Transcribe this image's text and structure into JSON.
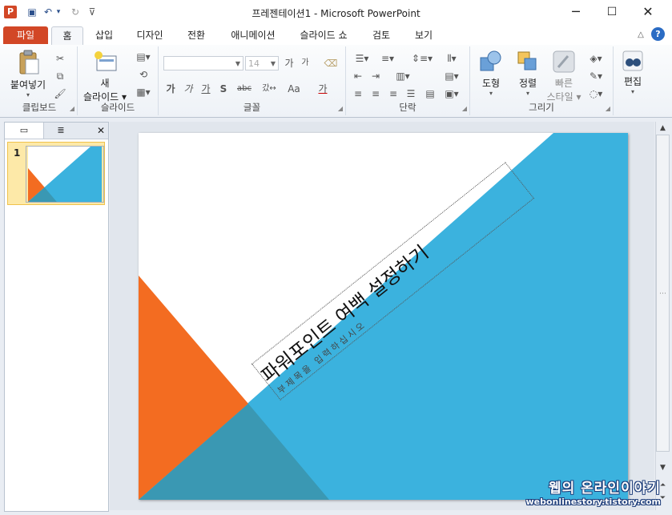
{
  "titlebar": {
    "title": "프레젠테이션1  -  Microsoft PowerPoint",
    "app_icon": "P",
    "save_glyph": "▣",
    "undo_glyph": "↶",
    "undo_dd": "▾",
    "redo_glyph": "↻",
    "qat_glyph": "⊽",
    "minimize": "─",
    "maximize": "☐",
    "close": "✕"
  },
  "tabs": [
    "파일",
    "홈",
    "삽입",
    "디자인",
    "전환",
    "애니메이션",
    "슬라이드 쇼",
    "검토",
    "보기"
  ],
  "ribbon_help": {
    "collapse": "△",
    "help": "?"
  },
  "ribbon": {
    "clipboard": {
      "label": "클립보드",
      "paste": "붙여넣기",
      "dd": "▾",
      "cut": "✂",
      "copy": "⧉",
      "format_painter": "🖌"
    },
    "slides": {
      "label": "슬라이드",
      "new_slide_1": "새",
      "new_slide_2": "슬라이드 ▾"
    },
    "font": {
      "label": "글꼴",
      "font_name": "",
      "font_size": "14",
      "grow": "가",
      "shrink": "가",
      "clear": "⌫",
      "bold": "가",
      "italic": "가",
      "underline": "가",
      "shadow": "S",
      "strike": "abc",
      "spacing": "갔↔",
      "case": "Aa",
      "color": "가"
    },
    "paragraph": {
      "label": "단락"
    },
    "drawing": {
      "label": "그리기",
      "shapes": "도형",
      "arrange": "정렬",
      "quick_styles_1": "빠른",
      "quick_styles_2": "스타일 ▾"
    },
    "editing": {
      "label": "편집",
      "edit": "편집"
    }
  },
  "left_pane": {
    "tab_slides": "▭",
    "tab_outline": "≣",
    "close": "✕",
    "thumb_number": "1"
  },
  "slide": {
    "title": "파워포인트 여백 설정하기",
    "subtitle": "부제목을 입력하십시오"
  },
  "scroll": {
    "up": "▲",
    "down": "▼",
    "prev": "⏶",
    "next": "⏷",
    "mid": "⋯"
  },
  "colors": {
    "orange": "#f36c21",
    "blue": "#3bb2de",
    "teal": "#3a98b3",
    "file_tab": "#d24726"
  },
  "watermark": {
    "line1": "웹의 온라인이야기",
    "line2": "webonlinestory.tistory.com"
  }
}
